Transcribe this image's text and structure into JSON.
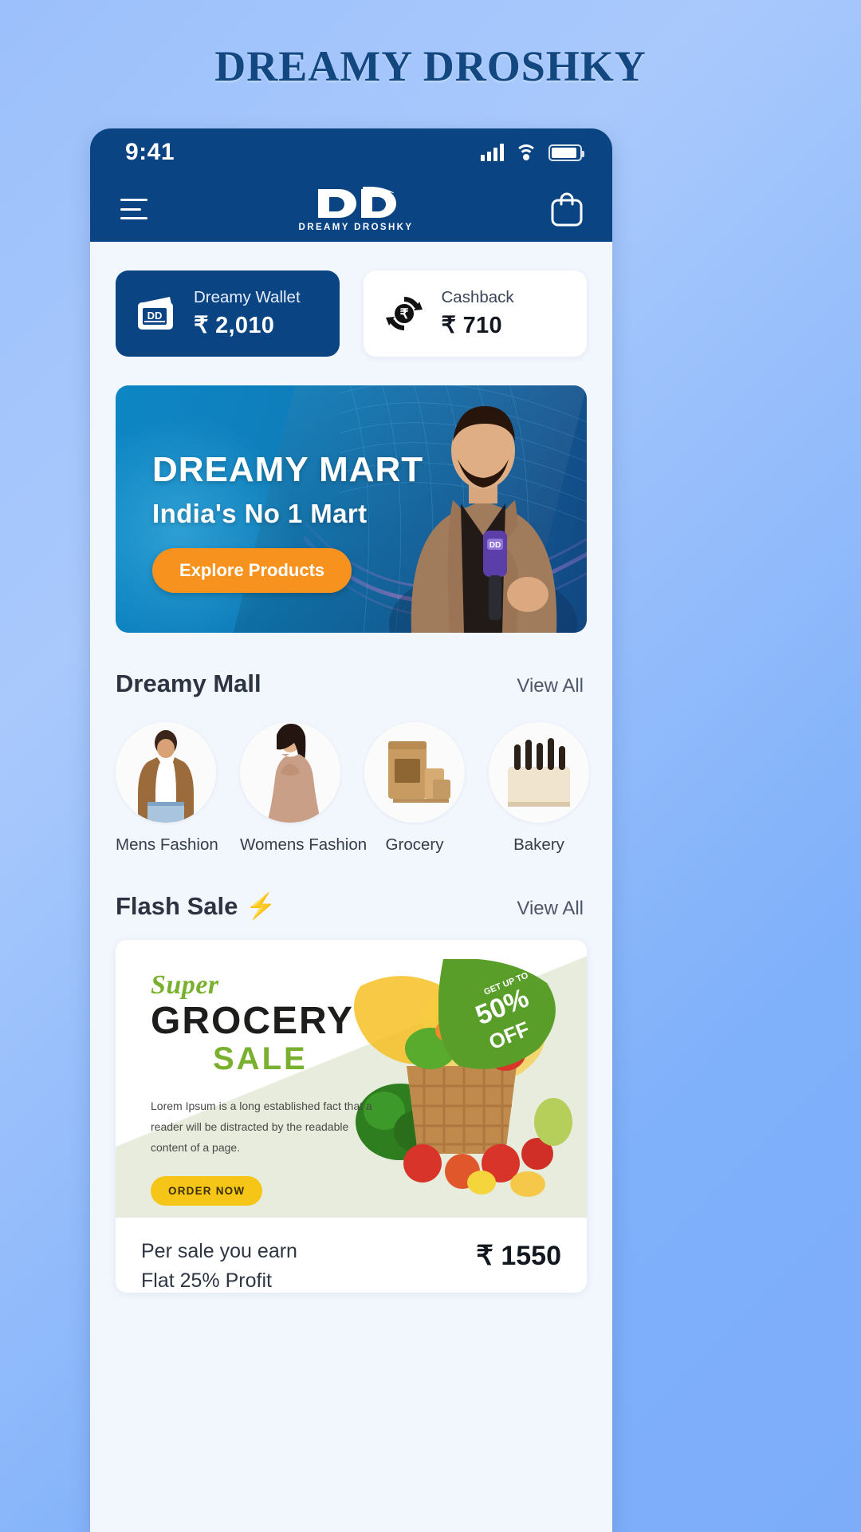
{
  "page": {
    "title": "DREAMY DROSHKY"
  },
  "status_bar": {
    "time": "9:41",
    "signal_icon": "cellular-bars-icon",
    "wifi_icon": "wifi-icon",
    "battery_icon": "battery-icon"
  },
  "app_header": {
    "menu_icon": "hamburger-menu-icon",
    "logo_mark": "dd-monogram-icon",
    "logo_subtitle": "DREAMY DROSHKY",
    "cart_icon": "shopping-bag-icon"
  },
  "wallet_cards": [
    {
      "icon": "wallet-icon",
      "label": "Dreamy Wallet",
      "amount": "₹ 2,010",
      "style": "blue"
    },
    {
      "icon": "cashback-rupee-refresh-icon",
      "label": "Cashback",
      "amount": "₹ 710",
      "style": "white"
    }
  ],
  "hero_banner": {
    "headline": "DREAMY MART",
    "subheadline": "India's No 1 Mart",
    "cta_label": "Explore Products",
    "cta_color": "#f7921e",
    "person_alt": "presenter-holding-microphone"
  },
  "dreamy_mall": {
    "title": "Dreamy Mall",
    "view_all": "View All",
    "categories": [
      {
        "label": "Mens Fashion",
        "image": "mens-fashion-photo"
      },
      {
        "label": "Womens Fashion",
        "image": "womens-fashion-photo"
      },
      {
        "label": "Grocery",
        "image": "grocery-tin-photo"
      },
      {
        "label": "Bakery",
        "image": "bakery-cake-photo"
      },
      {
        "label": "",
        "image": "next-category-photo"
      }
    ]
  },
  "flash_sale": {
    "title": "Flash Sale",
    "bolt_icon": "⚡",
    "view_all": "View All",
    "promo": {
      "super": "Super",
      "grocery": "GROCERY",
      "sale": "SALE",
      "body": "Lorem Ipsum is a long established fact that a reader will be distracted by the readable content of a page.",
      "cta_label": "ORDER NOW",
      "badge_top": "GET UP TO",
      "badge_pct": "50%",
      "badge_off": "OFF"
    },
    "earnings": {
      "line1": "Per sale you earn",
      "line2": "Flat 25% Profit",
      "amount": "₹ 1550"
    }
  },
  "colors": {
    "brand_navy": "#0a4483",
    "accent_orange": "#f7921e",
    "page_bg": "#f2f6fd"
  }
}
